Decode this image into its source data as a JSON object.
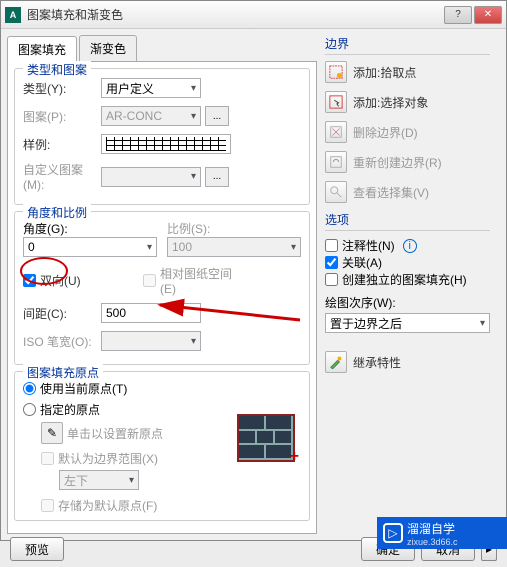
{
  "window": {
    "title": "图案填充和渐变色"
  },
  "tabs": {
    "fill": "图案填充",
    "grad": "渐变色"
  },
  "type_pattern": {
    "group": "类型和图案",
    "type_label": "类型(Y):",
    "type_value": "用户定义",
    "pattern_label": "图案(P):",
    "pattern_value": "AR-CONC",
    "sample_label": "样例:",
    "custom_label": "自定义图案(M):"
  },
  "angle_scale": {
    "group": "角度和比例",
    "angle_label": "角度(G):",
    "angle_value": "0",
    "scale_label": "比例(S):",
    "scale_value": "100",
    "bidir": "双向(U)",
    "paperspace": "相对图纸空间(E)",
    "spacing_label": "间距(C):",
    "spacing_value": "500",
    "iso_label": "ISO 笔宽(O):"
  },
  "origin": {
    "group": "图案填充原点",
    "use_current": "使用当前原点(T)",
    "specified": "指定的原点",
    "click_new": "单击以设置新原点",
    "default_ext": "默认为边界范围(X)",
    "pos": "左下",
    "store": "存储为默认原点(F)"
  },
  "boundary": {
    "title": "边界",
    "add_pick": "添加:拾取点",
    "add_select": "添加:选择对象",
    "delete": "删除边界(D)",
    "recreate": "重新创建边界(R)",
    "view_sel": "查看选择集(V)"
  },
  "options": {
    "title": "选项",
    "annotative": "注释性(N)",
    "associative": "关联(A)",
    "independent": "创建独立的图案填充(H)",
    "draworder_label": "绘图次序(W):",
    "draworder_value": "置于边界之后"
  },
  "inherit": {
    "label": "继承特性"
  },
  "buttons": {
    "preview": "预览",
    "ok": "确定",
    "cancel": "取消"
  },
  "watermark": {
    "name": "溜溜自学",
    "url": "zixue.3d66.c"
  }
}
